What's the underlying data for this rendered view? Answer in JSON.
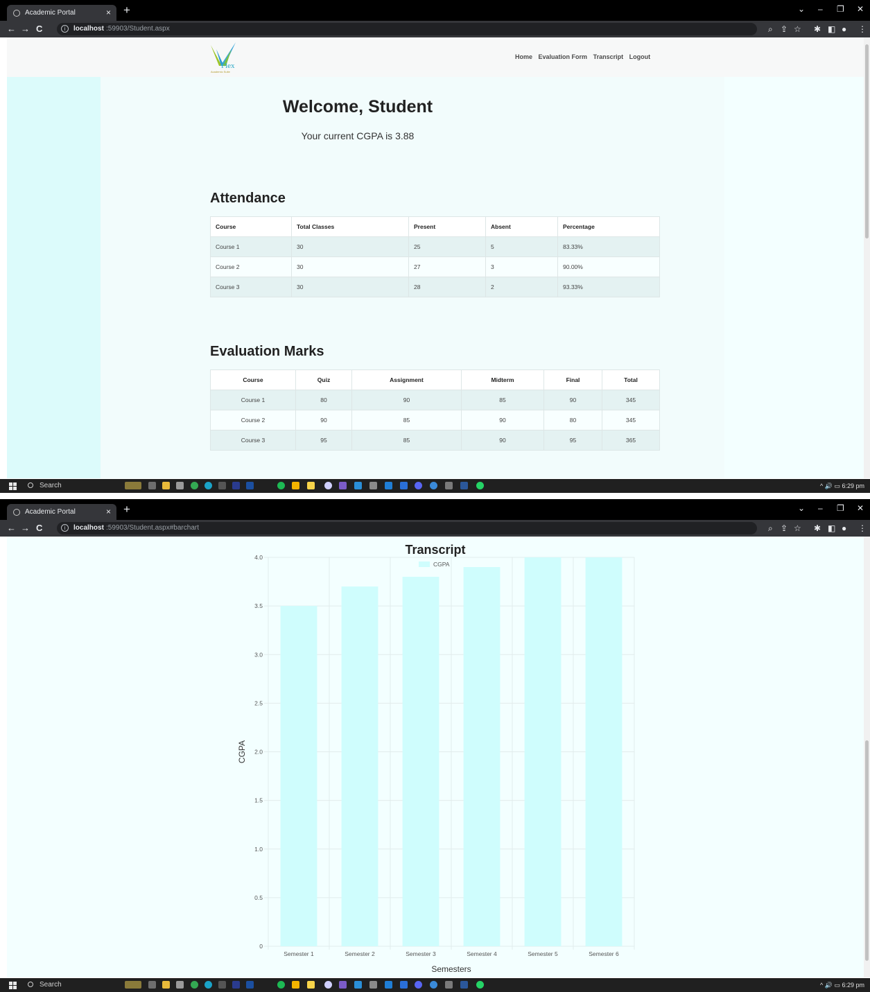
{
  "browser": {
    "tab_title": "Academic Portal",
    "tab_close": "×",
    "new_tab": "+",
    "url_host_1": "localhost",
    "url_path_1": ":59903/Student.aspx",
    "url_host_2": "localhost",
    "url_path_2": ":59903/Student.aspx#barchart"
  },
  "taskbar": {
    "search_label": "Search",
    "time": "6:29 pm"
  },
  "navbar": {
    "logo_text": "Flex",
    "logo_tagline": "Academic Suite",
    "links": [
      "Home",
      "Evaluation Form",
      "Transcript",
      "Logout"
    ]
  },
  "welcome": {
    "heading": "Welcome, Student",
    "cgpa_text": "Your current CGPA is 3.88"
  },
  "attendance": {
    "title": "Attendance",
    "headers": [
      "Course",
      "Total Classes",
      "Present",
      "Absent",
      "Percentage"
    ],
    "rows": [
      [
        "Course 1",
        "30",
        "25",
        "5",
        "83.33%"
      ],
      [
        "Course 2",
        "30",
        "27",
        "3",
        "90.00%"
      ],
      [
        "Course 3",
        "30",
        "28",
        "2",
        "93.33%"
      ]
    ]
  },
  "evaluation": {
    "title": "Evaluation Marks",
    "headers": [
      "Course",
      "Quiz",
      "Assignment",
      "Midterm",
      "Final",
      "Total"
    ],
    "rows": [
      [
        "Course 1",
        "80",
        "90",
        "85",
        "90",
        "345"
      ],
      [
        "Course 2",
        "90",
        "85",
        "90",
        "80",
        "345"
      ],
      [
        "Course 3",
        "95",
        "85",
        "90",
        "95",
        "365"
      ]
    ]
  },
  "transcript": {
    "title": "Transcript"
  },
  "chart_data": {
    "type": "bar",
    "categories": [
      "Semester 1",
      "Semester 2",
      "Semester 3",
      "Semester 4",
      "Semester 5",
      "Semester 6"
    ],
    "series": [
      {
        "name": "CGPA",
        "values": [
          3.5,
          3.7,
          3.8,
          3.9,
          4.0,
          4.0
        ]
      }
    ],
    "xlabel": "Semesters",
    "ylabel": "CGPA",
    "ylim": [
      0,
      4.0
    ],
    "yticks": [
      "4.0",
      "3.5",
      "3.0",
      "2.5",
      "2.0",
      "1.5",
      "1.0",
      "0.5",
      "0"
    ],
    "grid": true,
    "legend": "top",
    "bar_color": "#cffdfd",
    "grid_color": "#e2ecec"
  }
}
